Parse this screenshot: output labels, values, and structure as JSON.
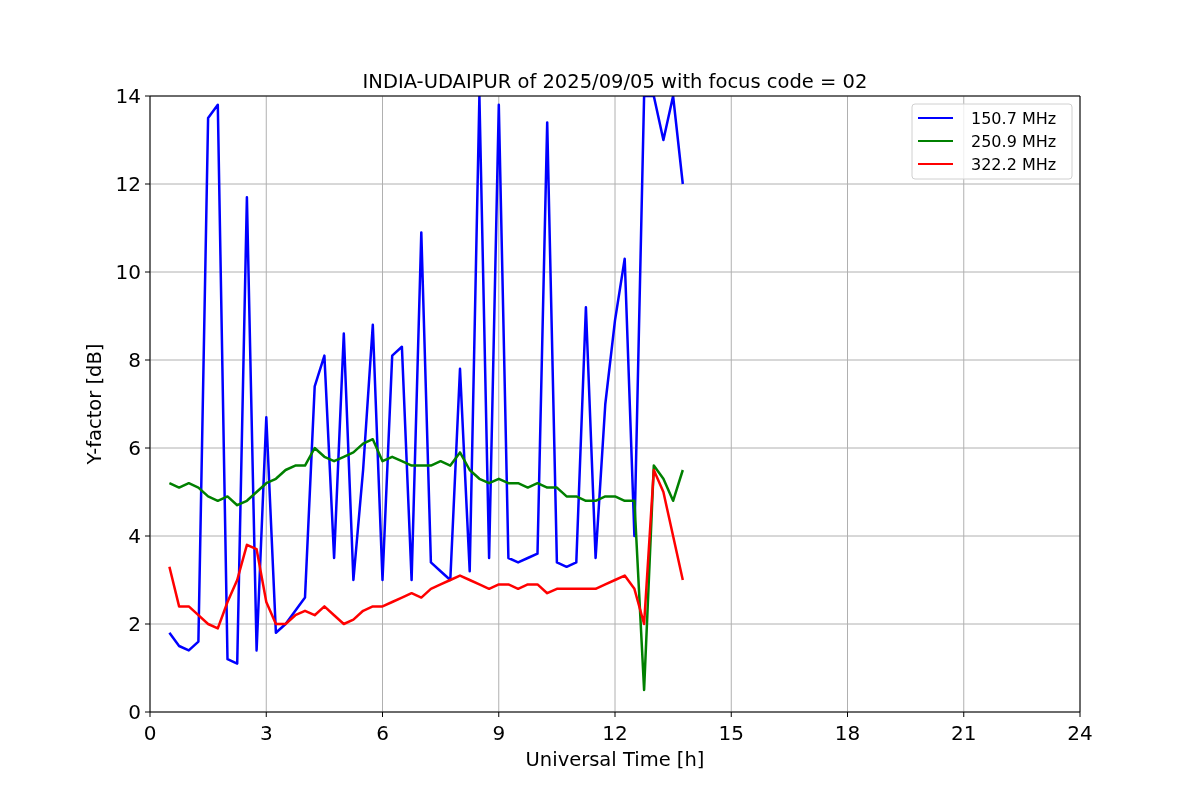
{
  "chart_data": {
    "type": "line",
    "title": "INDIA-UDAIPUR of 2025/09/05 with focus code = 02",
    "xlabel": "Universal Time [h]",
    "ylabel": "Y-factor [dB]",
    "x": [
      0.5,
      0.75,
      1.0,
      1.25,
      1.5,
      1.75,
      2.0,
      2.25,
      2.5,
      2.75,
      3.0,
      3.25,
      3.5,
      3.75,
      4.0,
      4.25,
      4.5,
      4.75,
      5.0,
      5.25,
      5.5,
      5.75,
      6.0,
      6.25,
      6.5,
      6.75,
      7.0,
      7.25,
      7.5,
      7.75,
      8.0,
      8.25,
      8.5,
      8.75,
      9.0,
      9.25,
      9.5,
      9.75,
      10.0,
      10.25,
      10.5,
      10.75,
      11.0,
      11.25,
      11.5,
      11.75,
      12.0,
      12.25,
      12.5,
      12.75,
      13.0,
      13.25,
      13.5,
      13.75
    ],
    "series": [
      {
        "name": "150.7 MHz",
        "color": "#0000ff",
        "values": [
          1.8,
          1.5,
          1.4,
          1.6,
          13.5,
          13.8,
          1.2,
          1.1,
          11.7,
          1.4,
          6.7,
          1.8,
          2.0,
          2.3,
          2.6,
          7.4,
          8.1,
          3.5,
          8.6,
          3.0,
          5.5,
          8.8,
          3.0,
          8.1,
          8.3,
          3.0,
          10.9,
          3.4,
          3.2,
          3.0,
          7.8,
          3.2,
          14.0,
          3.5,
          13.8,
          3.5,
          3.4,
          3.5,
          3.6,
          13.4,
          3.4,
          3.3,
          3.4,
          9.2,
          3.5,
          7.0,
          8.9,
          10.3,
          4.0,
          14.0,
          14.0,
          13.0,
          14.0,
          12.0
        ]
      },
      {
        "name": "250.9 MHz",
        "color": "#008000",
        "values": [
          5.2,
          5.1,
          5.2,
          5.1,
          4.9,
          4.8,
          4.9,
          4.7,
          4.8,
          5.0,
          5.2,
          5.3,
          5.5,
          5.6,
          5.6,
          6.0,
          5.8,
          5.7,
          5.8,
          5.9,
          6.1,
          6.2,
          5.7,
          5.8,
          5.7,
          5.6,
          5.6,
          5.6,
          5.7,
          5.6,
          5.9,
          5.5,
          5.3,
          5.2,
          5.3,
          5.2,
          5.2,
          5.1,
          5.2,
          5.1,
          5.1,
          4.9,
          4.9,
          4.8,
          4.8,
          4.9,
          4.9,
          4.8,
          4.8,
          0.5,
          5.6,
          5.3,
          4.8,
          5.5
        ]
      },
      {
        "name": "322.2 MHz",
        "color": "#ff0000",
        "values": [
          3.3,
          2.4,
          2.4,
          2.2,
          2.0,
          1.9,
          2.5,
          3.0,
          3.8,
          3.7,
          2.5,
          2.0,
          2.0,
          2.2,
          2.3,
          2.2,
          2.4,
          2.2,
          2.0,
          2.1,
          2.3,
          2.4,
          2.4,
          2.5,
          2.6,
          2.7,
          2.6,
          2.8,
          2.9,
          3.0,
          3.1,
          3.0,
          2.9,
          2.8,
          2.9,
          2.9,
          2.8,
          2.9,
          2.9,
          2.7,
          2.8,
          2.8,
          2.8,
          2.8,
          2.8,
          2.9,
          3.0,
          3.1,
          2.8,
          2.0,
          5.5,
          5.0,
          4.0,
          3.0
        ]
      }
    ],
    "xlim": [
      0,
      24
    ],
    "ylim": [
      0,
      14
    ],
    "xticks": [
      0,
      3,
      6,
      9,
      12,
      15,
      18,
      21,
      24
    ],
    "yticks": [
      0,
      2,
      4,
      6,
      8,
      10,
      12,
      14
    ],
    "grid": true,
    "legend": true
  }
}
